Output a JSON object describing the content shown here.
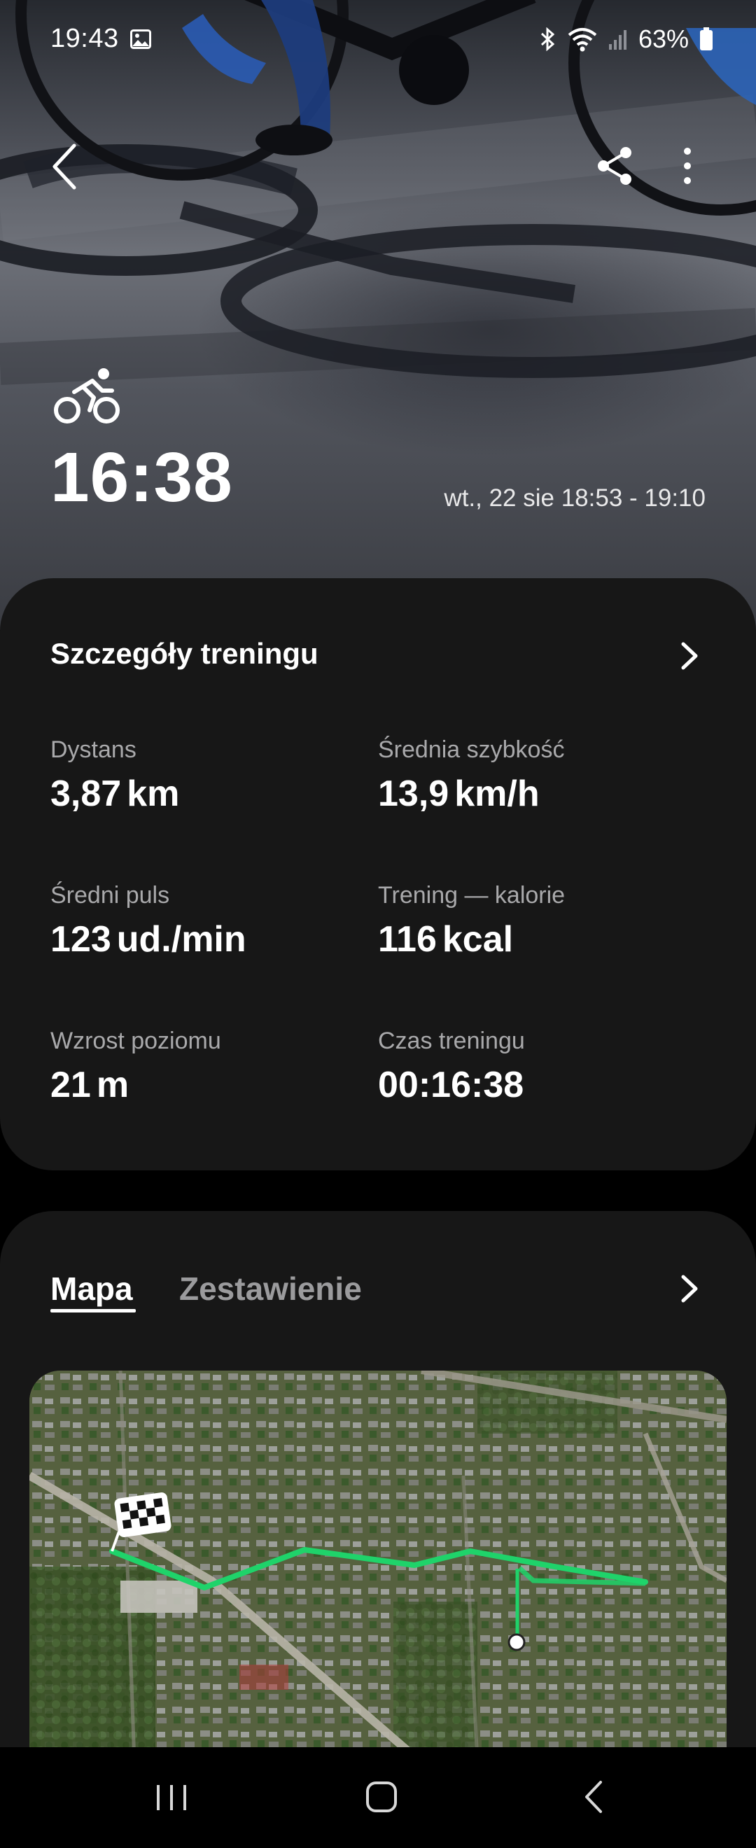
{
  "status_bar": {
    "time": "19:43",
    "battery_text": "63%",
    "icons": [
      "image-icon",
      "bluetooth-icon",
      "wifi-icon",
      "signal-icon",
      "battery-icon"
    ]
  },
  "top_bar": {
    "icons": [
      "back-arrow-icon",
      "share-icon",
      "more-vert-icon"
    ]
  },
  "workout": {
    "activity_icon": "cycling-icon",
    "duration": "16:38",
    "date_range": "wt., 22 sie 18:53 - 19:10"
  },
  "details": {
    "title": "Szczegóły treningu",
    "stats": [
      {
        "label": "Dystans",
        "value": "3,87",
        "unit": "km"
      },
      {
        "label": "Średnia szybkość",
        "value": "13,9",
        "unit": "km/h"
      },
      {
        "label": "Średni puls",
        "value": "123",
        "unit": "ud./min"
      },
      {
        "label": "Trening — kalorie",
        "value": "116",
        "unit": "kcal"
      },
      {
        "label": "Wzrost poziomu",
        "value": "21",
        "unit": "m"
      },
      {
        "label": "Czas treningu",
        "value": "00:16:38",
        "unit": ""
      }
    ]
  },
  "map_section": {
    "tabs": [
      {
        "label": "Mapa",
        "selected": true
      },
      {
        "label": "Zestawienie",
        "selected": false
      }
    ],
    "route_color": "#1fd36a",
    "markers": [
      "finish-flag-icon",
      "start-point-icon"
    ]
  },
  "colors": {
    "card_bg": "#171717",
    "label_gray": "#a9a9ab",
    "route_green": "#1fd36a"
  },
  "nav_bar": {
    "icons": [
      "recent-apps-icon",
      "home-icon",
      "nav-back-icon"
    ]
  }
}
